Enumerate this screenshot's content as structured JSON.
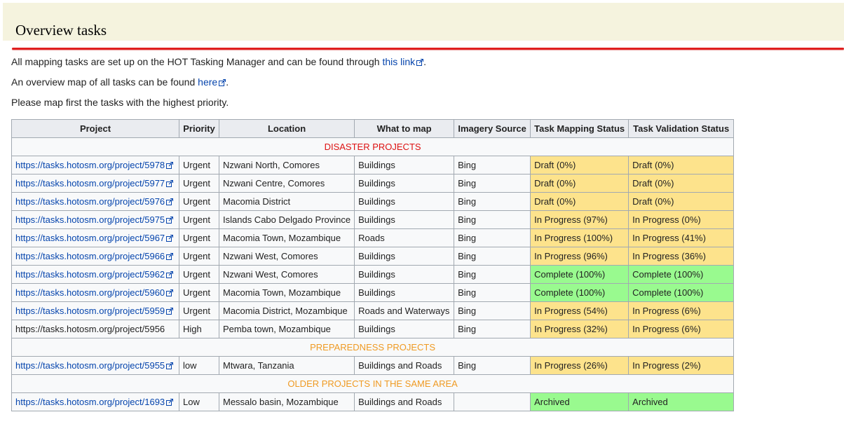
{
  "heading": "Overview tasks",
  "paragraphs": {
    "p1_text": "All mapping tasks are set up on the HOT Tasking Manager and can be found through ",
    "p1_link": "this link",
    "p1_end": ".",
    "p2_text": "An overview map of all tasks can be found ",
    "p2_link": "here",
    "p2_end": ".",
    "p3_text": "Please map first the tasks with the highest priority."
  },
  "colors": {
    "draft_inprogress": "#fde38c",
    "complete_archived": "#99fa8f",
    "disaster_header": "#dd1111",
    "other_header": "#ef9a23",
    "link": "#0645ad"
  },
  "table": {
    "headers": [
      "Project",
      "Priority",
      "Location",
      "What to map",
      "Imagery Source",
      "Task Mapping Status",
      "Task Validation Status"
    ],
    "sections": [
      {
        "title": "DISASTER PROJECTS",
        "color": "#dd1111",
        "rows": [
          {
            "project": "https://tasks.hotosm.org/project/5978",
            "linked": true,
            "priority": "Urgent",
            "location": "Nzwani North, Comores",
            "what": "Buildings",
            "imagery": "Bing",
            "mapping": "Draft (0%)",
            "mapping_status": "yellow",
            "validation": "Draft (0%)",
            "validation_status": "yellow"
          },
          {
            "project": "https://tasks.hotosm.org/project/5977",
            "linked": true,
            "priority": "Urgent",
            "location": "Nzwani Centre, Comores",
            "what": "Buildings",
            "imagery": "Bing",
            "mapping": "Draft (0%)",
            "mapping_status": "yellow",
            "validation": "Draft (0%)",
            "validation_status": "yellow"
          },
          {
            "project": "https://tasks.hotosm.org/project/5976",
            "linked": true,
            "priority": "Urgent",
            "location": "Macomia District",
            "what": "Buildings",
            "imagery": "Bing",
            "mapping": "Draft (0%)",
            "mapping_status": "yellow",
            "validation": "Draft (0%)",
            "validation_status": "yellow"
          },
          {
            "project": "https://tasks.hotosm.org/project/5975",
            "linked": true,
            "priority": "Urgent",
            "location": "Islands Cabo Delgado Province",
            "what": "Buildings",
            "imagery": "Bing",
            "mapping": "In Progress (97%)",
            "mapping_status": "yellow",
            "validation": "In Progress (0%)",
            "validation_status": "yellow"
          },
          {
            "project": "https://tasks.hotosm.org/project/5967",
            "linked": true,
            "priority": "Urgent",
            "location": "Macomia Town, Mozambique",
            "what": "Roads",
            "imagery": "Bing",
            "mapping": "In Progress (100%)",
            "mapping_status": "yellow",
            "validation": "In Progress (41%)",
            "validation_status": "yellow"
          },
          {
            "project": "https://tasks.hotosm.org/project/5966",
            "linked": true,
            "priority": "Urgent",
            "location": "Nzwani West, Comores",
            "what": "Buildings",
            "imagery": "Bing",
            "mapping": "In Progress (96%)",
            "mapping_status": "yellow",
            "validation": "In Progress (36%)",
            "validation_status": "yellow"
          },
          {
            "project": "https://tasks.hotosm.org/project/5962",
            "linked": true,
            "priority": "Urgent",
            "location": "Nzwani West, Comores",
            "what": "Buildings",
            "imagery": "Bing",
            "mapping": "Complete (100%)",
            "mapping_status": "green",
            "validation": "Complete (100%)",
            "validation_status": "green"
          },
          {
            "project": "https://tasks.hotosm.org/project/5960",
            "linked": true,
            "priority": "Urgent",
            "location": "Macomia Town, Mozambique",
            "what": "Buildings",
            "imagery": "Bing",
            "mapping": "Complete (100%)",
            "mapping_status": "green",
            "validation": "Complete (100%)",
            "validation_status": "green"
          },
          {
            "project": "https://tasks.hotosm.org/project/5959",
            "linked": true,
            "priority": "Urgent",
            "location": "Macomia District, Mozambique",
            "what": "Roads and Waterways",
            "imagery": "Bing",
            "mapping": "In Progress (54%)",
            "mapping_status": "yellow",
            "validation": "In Progress (6%)",
            "validation_status": "yellow"
          },
          {
            "project": "https://tasks.hotosm.org/project/5956",
            "linked": false,
            "priority": "High",
            "location": "Pemba town, Mozambique",
            "what": "Buildings",
            "imagery": "Bing",
            "mapping": "In Progress (32%)",
            "mapping_status": "yellow",
            "validation": "In Progress (6%)",
            "validation_status": "yellow"
          }
        ]
      },
      {
        "title": "PREPAREDNESS PROJECTS",
        "color": "#ef9a23",
        "rows": [
          {
            "project": "https://tasks.hotosm.org/project/5955",
            "linked": true,
            "priority": "low",
            "location": "Mtwara, Tanzania",
            "what": "Buildings and Roads",
            "imagery": "Bing",
            "mapping": "In Progress (26%)",
            "mapping_status": "yellow",
            "validation": "In Progress (2%)",
            "validation_status": "yellow"
          }
        ]
      },
      {
        "title": "OLDER PROJECTS IN THE SAME AREA",
        "color": "#ef9a23",
        "rows": [
          {
            "project": "https://tasks.hotosm.org/project/1693",
            "linked": true,
            "priority": "Low",
            "location": "Messalo basin, Mozambique",
            "what": "Buildings and Roads",
            "imagery": "",
            "mapping": "Archived",
            "mapping_status": "green",
            "validation": "Archived",
            "validation_status": "green"
          }
        ]
      }
    ]
  }
}
